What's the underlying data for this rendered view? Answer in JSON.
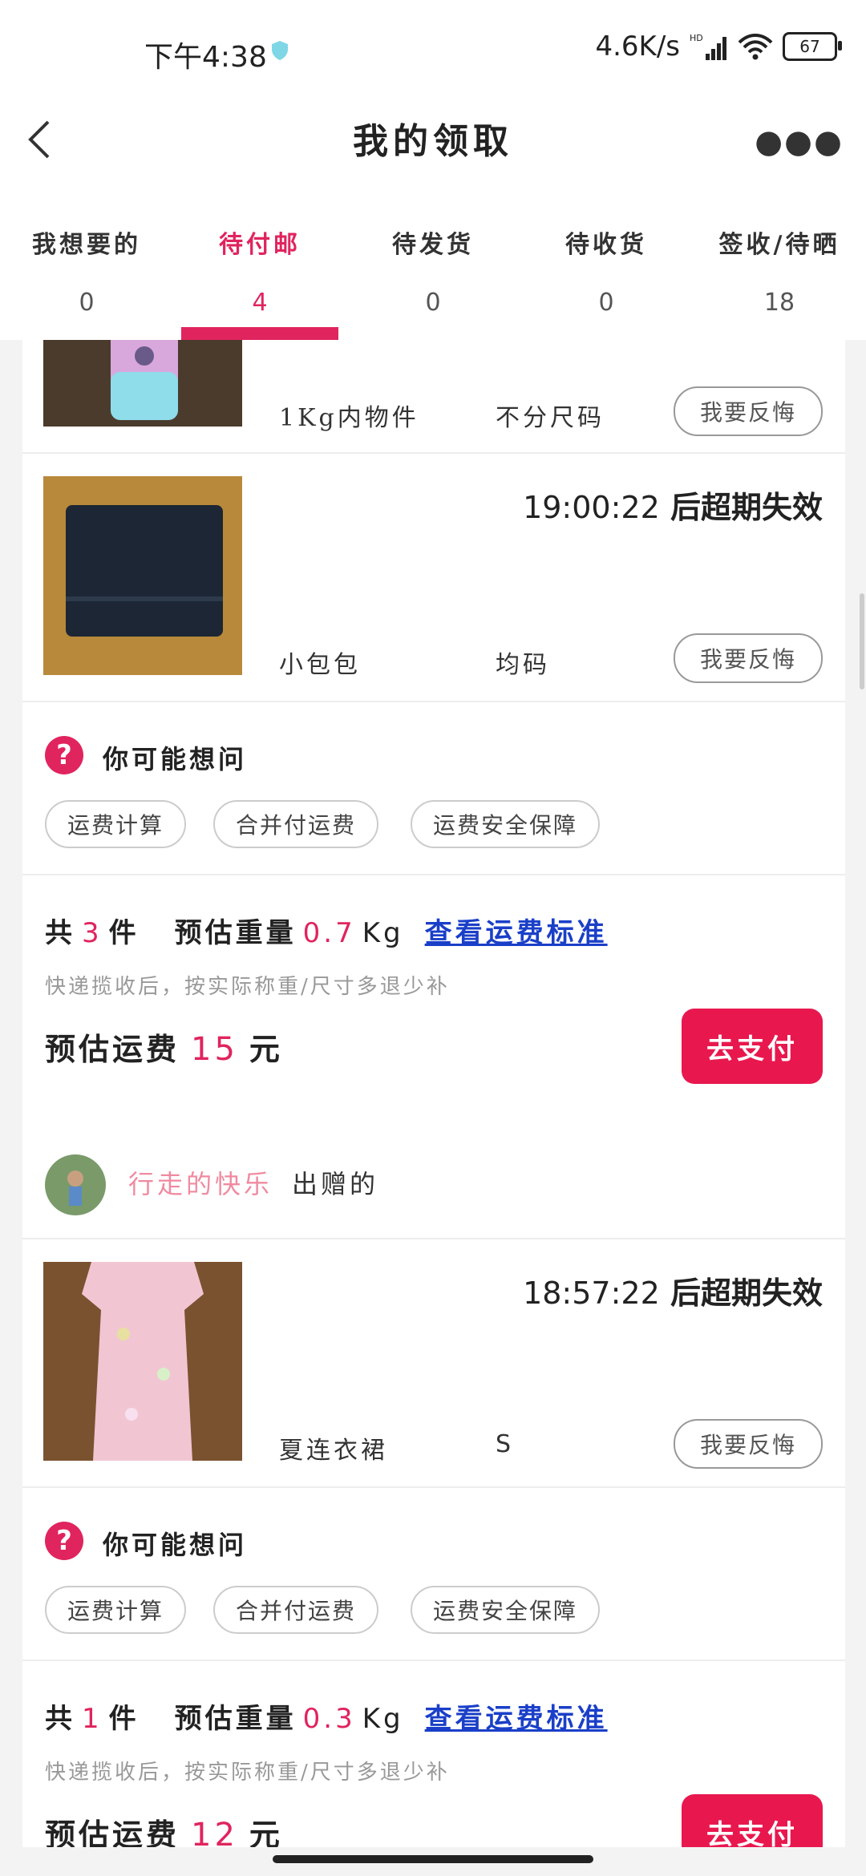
{
  "status": {
    "time": "下午4:38",
    "net_speed": "4.6K/s",
    "network": "HD",
    "battery": "67"
  },
  "nav": {
    "title": "我的领取"
  },
  "tabs": [
    {
      "label": "我想要的",
      "count": "0"
    },
    {
      "label": "待付邮",
      "count": "4",
      "active": true
    },
    {
      "label": "待发货",
      "count": "0"
    },
    {
      "label": "待收货",
      "count": "0"
    },
    {
      "label": "签收/待晒",
      "count": "18"
    }
  ],
  "order1": {
    "item1": {
      "name": "1Kg内物件",
      "size": "不分尺码",
      "regret": "我要反悔"
    },
    "item2": {
      "countdown": "19:00:22",
      "expire_text": "后超期失效",
      "name": "小包包",
      "size": "均码",
      "regret": "我要反悔"
    },
    "faq": {
      "title": "你可能想问",
      "chips": [
        "运费计算",
        "合并付运费",
        "运费安全保障"
      ]
    },
    "summary": {
      "total_prefix": "共",
      "count": "3",
      "count_unit": "件",
      "weight_label": "预估重量",
      "weight": "0.7",
      "weight_unit": "Kg",
      "link": "查看运费标准",
      "note": "快递揽收后，按实际称重/尺寸多退少补",
      "fee_label": "预估运费",
      "fee": "15",
      "fee_unit": "元",
      "pay": "去支付"
    }
  },
  "order2": {
    "user": {
      "name": "行走的快乐",
      "action": "出赠的"
    },
    "item1": {
      "countdown": "18:57:22",
      "expire_text": "后超期失效",
      "name": "夏连衣裙",
      "size": "S",
      "regret": "我要反悔"
    },
    "faq": {
      "title": "你可能想问",
      "chips": [
        "运费计算",
        "合并付运费",
        "运费安全保障"
      ]
    },
    "summary": {
      "total_prefix": "共",
      "count": "1",
      "count_unit": "件",
      "weight_label": "预估重量",
      "weight": "0.3",
      "weight_unit": "Kg",
      "link": "查看运费标准",
      "note": "快递揽收后，按实际称重/尺寸多退少补",
      "fee_label": "预估运费",
      "fee": "12",
      "fee_unit": "元",
      "pay": "去支付"
    }
  },
  "colors": {
    "accent": "#e0245e",
    "link": "#1a3fc8",
    "username": "#f08aa0"
  }
}
